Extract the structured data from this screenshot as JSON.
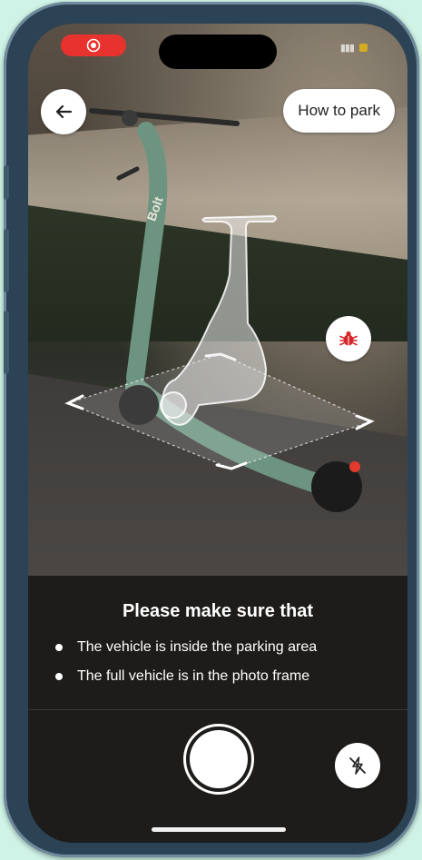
{
  "header": {
    "back_icon": "arrow-left-icon",
    "how_to_park_label": "How to park"
  },
  "camera": {
    "debug_icon": "bug-icon",
    "overlay_icon": "scooter-outline-icon",
    "brand_text": "Bolt"
  },
  "instructions": {
    "title": "Please make sure that",
    "items": [
      "The vehicle is inside the parking area",
      "The full vehicle is in the photo frame"
    ]
  },
  "controls": {
    "shutter_icon": "shutter-button-icon",
    "flash_icon": "flash-off-icon"
  },
  "colors": {
    "recording": "#e8322e",
    "debug_red": "#d7262b",
    "panel_bg": "#1e1c1a"
  }
}
